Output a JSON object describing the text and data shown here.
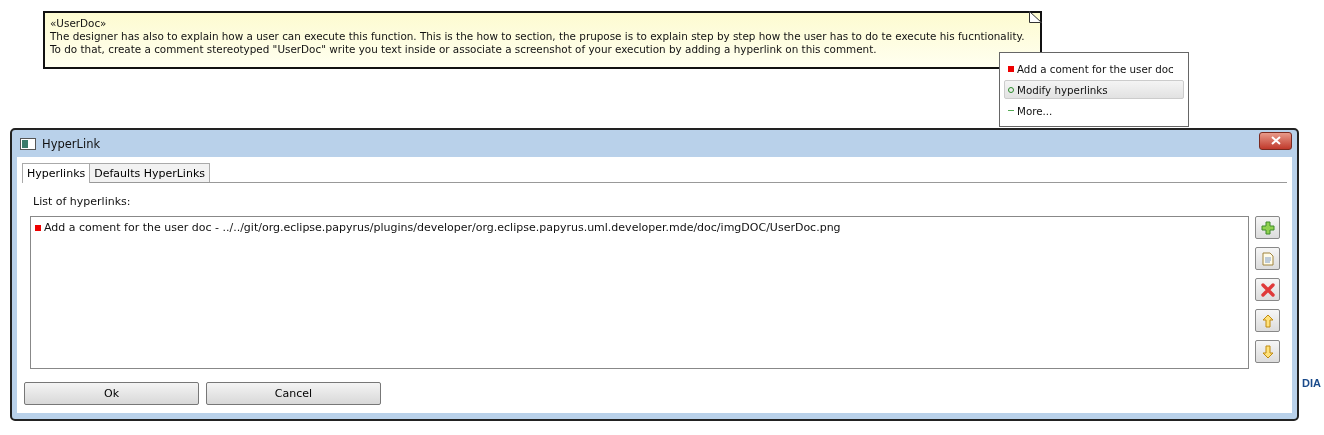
{
  "note": {
    "stereotype": "«UserDoc»",
    "lines": [
      "The designer has also to explain how a user can execute this function. This is the how to section, the prupose is to explain step by step how the user has to do te execute his fucntionality.",
      "To do that, create a comment stereotyped \"UserDoc\" write you text inside or associate a screenshot of your execution by adding a hyperlink on this comment."
    ]
  },
  "popup_menu": [
    {
      "label": "Add a coment for the user doc",
      "kind": "link",
      "selected": false
    },
    {
      "label": "Modify hyperlinks",
      "kind": "action",
      "selected": true
    },
    {
      "label": "More...",
      "kind": "more",
      "selected": false
    }
  ],
  "background": {
    "fragment": "DIA"
  },
  "dialog": {
    "title": "HyperLink",
    "tabs": [
      {
        "label": "Hyperlinks",
        "selected": true
      },
      {
        "label": "Defaults HyperLinks",
        "selected": false
      }
    ],
    "list_label": "List of hyperlinks:",
    "hyperlinks": [
      "Add a coment for the user doc - ../../git/org.eclipse.papyrus/plugins/developer/org.eclipse.papyrus.uml.developer.mde/doc/imgDOC/UserDoc.png"
    ],
    "side_buttons": [
      {
        "kind": "add"
      },
      {
        "kind": "edit"
      },
      {
        "kind": "delete"
      },
      {
        "kind": "up"
      },
      {
        "kind": "down"
      }
    ],
    "buttons": [
      "Ok",
      "Cancel"
    ]
  }
}
